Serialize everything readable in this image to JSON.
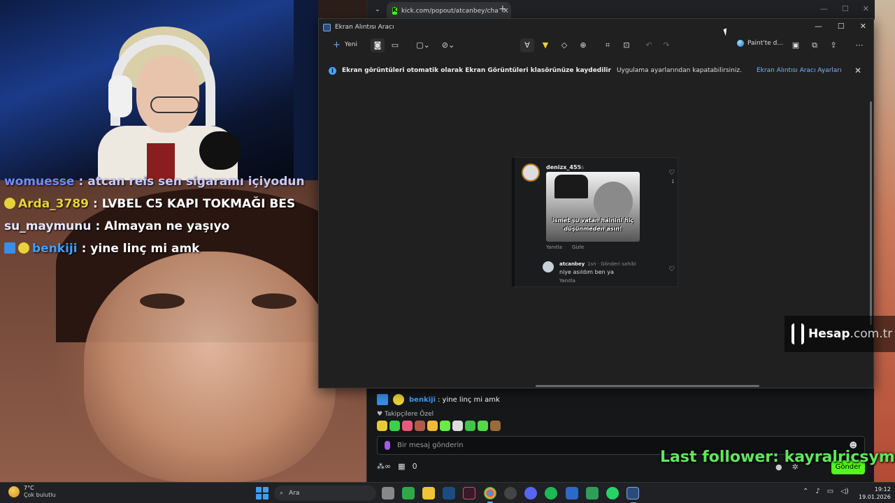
{
  "stream_chat": [
    {
      "user": "womuesse",
      "text": ": atcan reis sen sigaramı içiyodun",
      "badges": []
    },
    {
      "user": "Arda_3789",
      "text": ": LVBEL C5 KAPI TOKMAĞI BES",
      "badges": [
        "radioactive"
      ]
    },
    {
      "user": "su_maymunu",
      "text": ": Almayan ne yaşıyo",
      "badges": []
    },
    {
      "user": "benkiji",
      "text": ": yine linç mi amk",
      "badges": [
        "pickaxe",
        "radioactive"
      ]
    }
  ],
  "browser": {
    "tab_title": "kick.com/popout/atcanbey/cha",
    "chat_user": "benkiji",
    "chat_text": ": yine linç mi amk",
    "follower_only": "Takipçilere Özel",
    "input_placeholder": "Bir mesaj gönderin",
    "viewer_count": "0",
    "send_label": "Gönder"
  },
  "snipping_tool": {
    "title": "Ekran Alıntısı Aracı",
    "new_label": "Yeni",
    "paint_label": "Paint'te d...",
    "info_bold": "Ekran görüntüleri otomatik olarak Ekran Görüntüleri klasörünüze kaydedilir",
    "info_text": "Uygulama ayarlarından kapatabilirsiniz.",
    "info_link": "Ekran Alıntısı Aracı Ayarları"
  },
  "captured_post": {
    "author": "denizx_455",
    "time": "1s",
    "likes": "1",
    "image_caption": "ismet şu vatan hainini hiç düşünmeden asın!",
    "action_reply": "Yanıtla",
    "action_hide": "Gizle",
    "reply_author": "atcanbey",
    "reply_meta": "1sn · Gönderi sahibi",
    "reply_text": "niye asıldım ben ya",
    "reply_action": "Yanıtla"
  },
  "watermark": {
    "name_bold": "Hesap",
    "name_thin": ".com.tr"
  },
  "last_follower": "Last follower: kayralricsym",
  "taskbar": {
    "temperature": "7°C",
    "condition": "Çok bulutlu",
    "search_placeholder": "Ara",
    "time": "19:12",
    "date": "19.01.2026"
  }
}
